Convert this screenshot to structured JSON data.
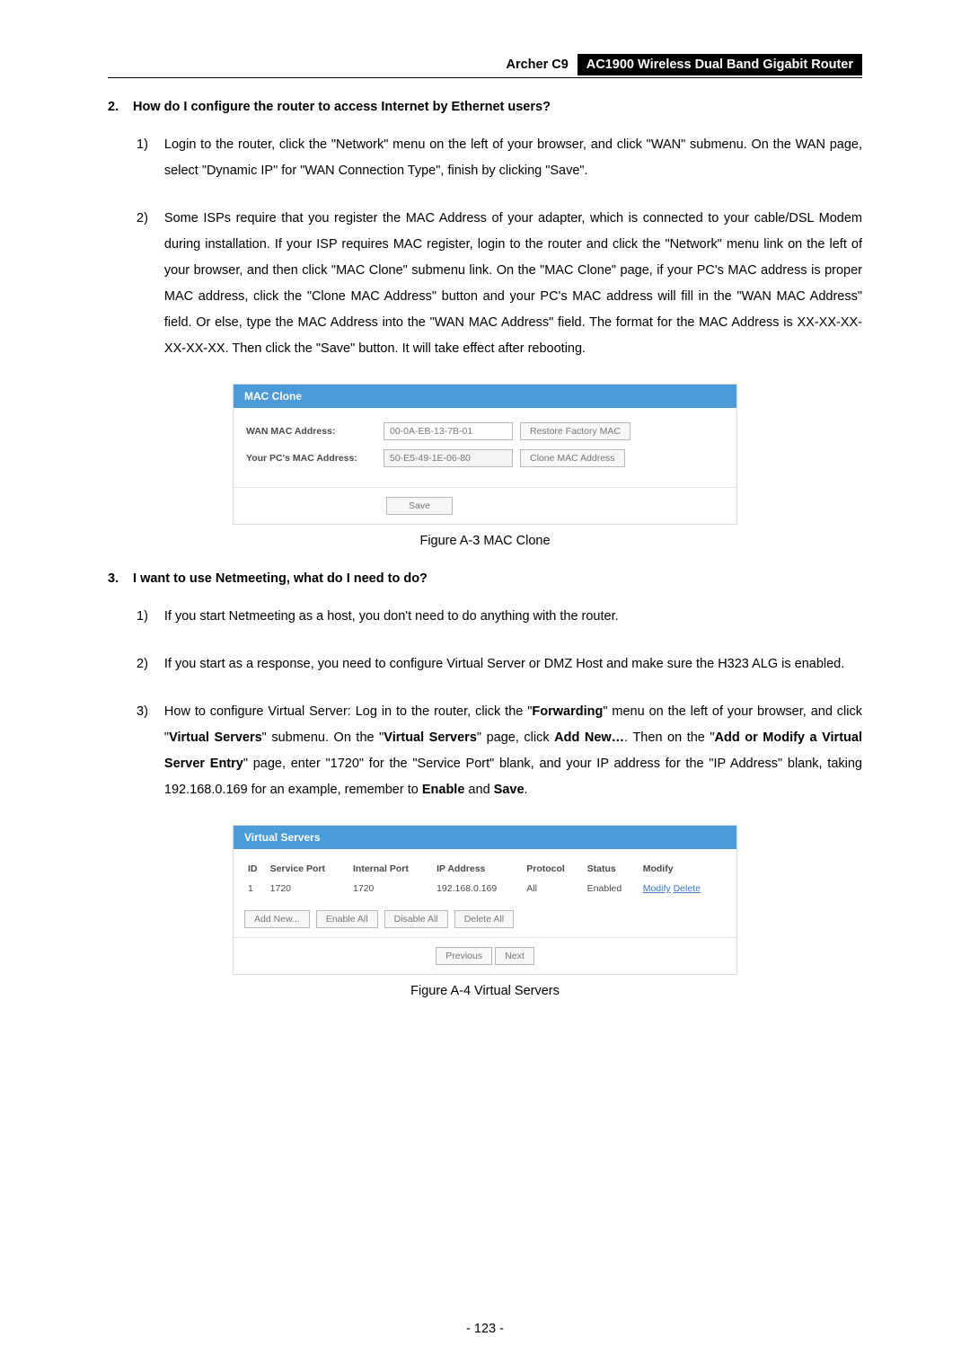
{
  "header": {
    "left": "Archer C9",
    "right": "AC1900 Wireless Dual Band Gigabit Router"
  },
  "sec2": {
    "title": "How do I configure the router to access Internet by Ethernet users?",
    "num": "2.",
    "items": {
      "n1": "1)",
      "b1": "Login to the router, click the \"Network\" menu on the left of your browser, and click \"WAN\" submenu. On the WAN page, select \"Dynamic IP\" for \"WAN Connection Type\", finish by clicking \"Save\".",
      "n2": "2)",
      "b2": "Some ISPs require that you register the MAC Address of your adapter, which is connected to your cable/DSL Modem during installation. If your ISP requires MAC register, login to the router and click the \"Network\" menu link on the left of your browser, and then click \"MAC Clone\" submenu link. On the \"MAC Clone\" page, if your PC's MAC address is proper MAC address, click the \"Clone MAC Address\" button and your PC's MAC address will fill in the \"WAN MAC Address\" field. Or else, type the MAC Address into the \"WAN MAC Address\" field. The format for the MAC Address is XX-XX-XX-XX-XX-XX. Then click the \"Save\" button. It will take effect after rebooting."
    }
  },
  "mac_clone": {
    "panel_title": "MAC Clone",
    "row1_label": "WAN MAC Address:",
    "row1_value": "00-0A-EB-13-7B-01",
    "row1_btn": "Restore Factory MAC",
    "row2_label": "Your PC's MAC Address:",
    "row2_value": "50-E5-49-1E-06-80",
    "row2_btn": "Clone MAC Address",
    "save": "Save",
    "caption": "Figure A-3 MAC Clone"
  },
  "sec3": {
    "title": "I want to use Netmeeting, what do I need to do?",
    "num": "3.",
    "items": {
      "n1": "1)",
      "b1": "If you start Netmeeting as a host, you don't need to do anything with the router.",
      "n2": "2)",
      "b2": "If you start as a response, you need to configure Virtual Server or DMZ Host and make sure the H323 ALG is enabled.",
      "n3": "3)",
      "b3_prefix": "How to configure Virtual Server: Log in to the router, click the \"",
      "b3_fwd": "Forwarding",
      "b3_mid1": "\" menu on the left of your browser, and click \"",
      "b3_vs1": "Virtual Servers",
      "b3_mid2": "\" submenu. On the \"",
      "b3_vs2": "Virtual Servers",
      "b3_mid3": "\" page, click ",
      "b3_add": "Add New…",
      "b3_mid4": ". Then on the \"",
      "b3_addmod": "Add or Modify a Virtual Server Entry",
      "b3_mid5": "\" page, enter \"1720\" for the \"Service Port\" blank, and your IP address for the \"IP Address\" blank, taking 192.168.0.169 for an example, remember to ",
      "b3_enable": "Enable",
      "b3_and": " and ",
      "b3_save": "Save",
      "b3_end": "."
    }
  },
  "virtual_servers": {
    "panel_title": "Virtual Servers",
    "cols": {
      "id": "ID",
      "sp": "Service Port",
      "ip_col": "Internal Port",
      "ipaddr": "IP Address",
      "proto": "Protocol",
      "status": "Status",
      "mod": "Modify"
    },
    "row": {
      "id": "1",
      "sp": "1720",
      "ip": "1720",
      "ipaddr": "192.168.0.169",
      "proto": "All",
      "status": "Enabled",
      "modify": "Modify",
      "delete": "Delete"
    },
    "btns": {
      "add": "Add New...",
      "en": "Enable All",
      "dis": "Disable All",
      "del": "Delete All",
      "prev": "Previous",
      "next": "Next"
    },
    "caption": "Figure A-4 Virtual Servers"
  },
  "page_number": "- 123 -"
}
